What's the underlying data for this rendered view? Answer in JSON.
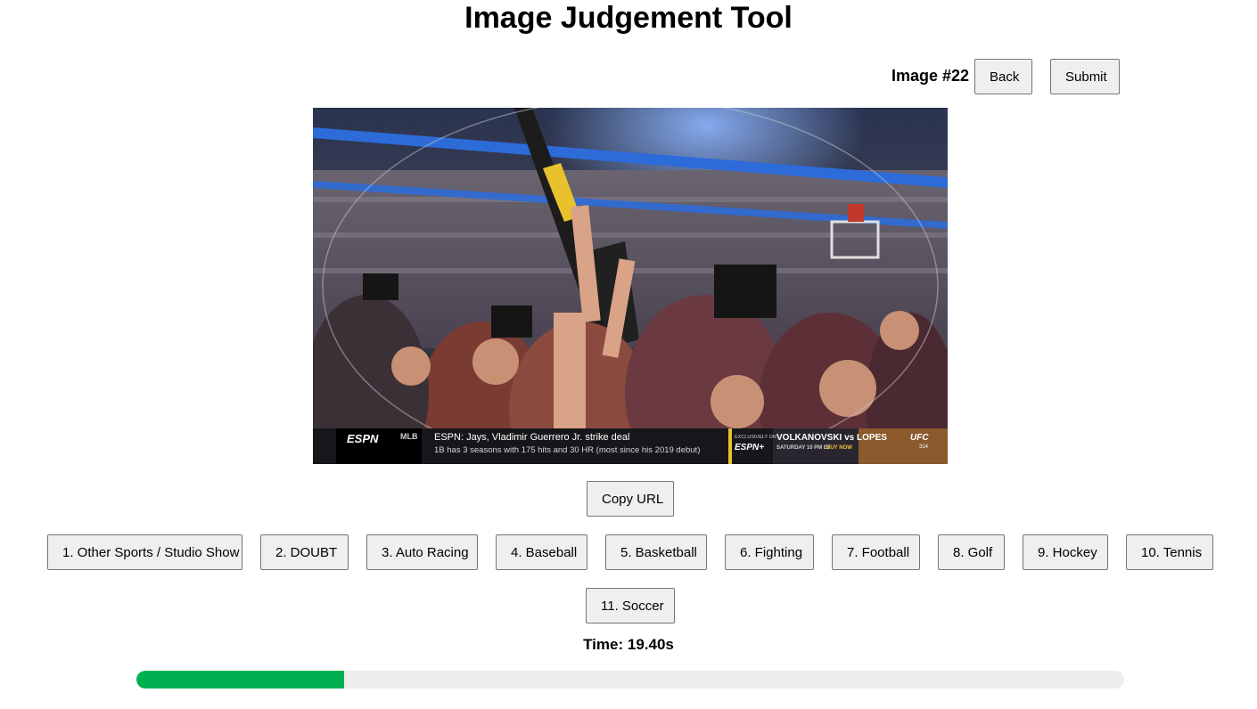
{
  "header": {
    "title": "Image Judgement Tool"
  },
  "nav": {
    "image_label": "Image #22",
    "back_label": "Back",
    "submit_label": "Submit"
  },
  "image": {
    "ticker": {
      "network": "ESPN",
      "league": "MLB",
      "headline": "ESPN: Jays, Vladimir Guerrero Jr. strike deal",
      "subline": "1B has 3 seasons with 175 hits and 30 HR (most since his 2019 debut)",
      "ad_tag": "EXCLUSIVELY ON",
      "ad_network": "ESPN+",
      "ad_title": "VOLKANOVSKI vs LOPES",
      "ad_time": "SATURDAY 10 PM ET",
      "ad_cta": "BUY NOW",
      "ad_brand": "UFC",
      "ad_event": "314"
    }
  },
  "actions": {
    "copy_url_label": "Copy URL"
  },
  "categories": [
    "1. Other Sports / Studio Show",
    "2. DOUBT",
    "3. Auto Racing",
    "4. Baseball",
    "5. Basketball",
    "6. Fighting",
    "7. Football",
    "8. Golf",
    "9. Hockey",
    "10. Tennis",
    "11. Soccer"
  ],
  "status": {
    "time_text": "Time: 19.40s",
    "progress_fraction": 0.21
  },
  "colors": {
    "progress_fill": "#00b050",
    "progress_track": "#eeeeee",
    "button_bg": "#efefef"
  }
}
